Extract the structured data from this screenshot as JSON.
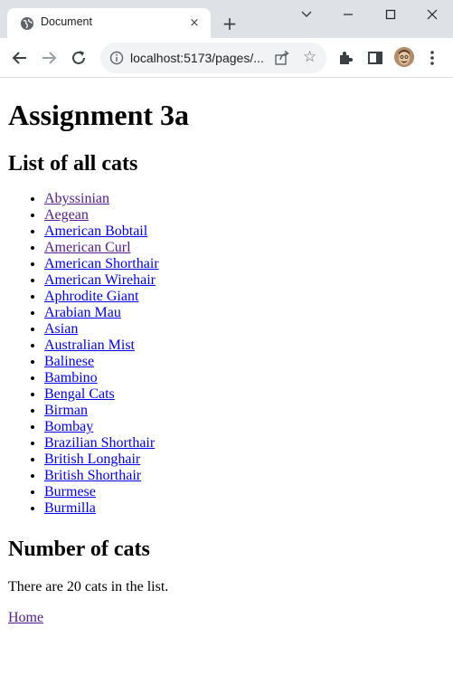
{
  "browser": {
    "tab_title": "Document",
    "url": "localhost:5173/pages/...",
    "new_tab_label": "+",
    "tab_close_label": "×"
  },
  "page": {
    "heading": "Assignment 3a",
    "list_heading": "List of all cats",
    "cats": [
      {
        "name": "Abyssinian",
        "visited": true
      },
      {
        "name": "Aegean",
        "visited": true
      },
      {
        "name": "American Bobtail",
        "visited": false
      },
      {
        "name": "American Curl",
        "visited": true
      },
      {
        "name": "American Shorthair",
        "visited": false
      },
      {
        "name": "American Wirehair",
        "visited": false
      },
      {
        "name": "Aphrodite Giant",
        "visited": false
      },
      {
        "name": "Arabian Mau",
        "visited": false
      },
      {
        "name": "Asian",
        "visited": false
      },
      {
        "name": "Australian Mist",
        "visited": false
      },
      {
        "name": "Balinese",
        "visited": false
      },
      {
        "name": "Bambino",
        "visited": false
      },
      {
        "name": "Bengal Cats",
        "visited": false
      },
      {
        "name": "Birman",
        "visited": false
      },
      {
        "name": "Bombay",
        "visited": false
      },
      {
        "name": "Brazilian Shorthair",
        "visited": false
      },
      {
        "name": "British Longhair",
        "visited": false
      },
      {
        "name": "British Shorthair",
        "visited": false
      },
      {
        "name": "Burmese",
        "visited": false
      },
      {
        "name": "Burmilla",
        "visited": false
      }
    ],
    "count_heading": "Number of cats",
    "count_text": "There are 20 cats in the list.",
    "home_link": "Home"
  },
  "colors": {
    "link": "#0000ee",
    "visited_link": "#551a8b",
    "tabstrip": "#dee1e6"
  }
}
